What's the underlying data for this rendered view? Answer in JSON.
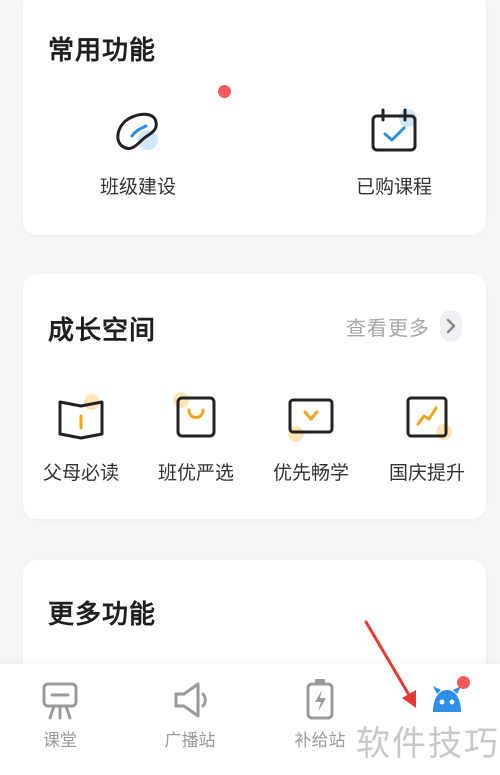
{
  "common": {
    "title": "常用功能",
    "items": [
      {
        "label": "班级建设",
        "icon": "bean-icon"
      },
      {
        "label": "已购课程",
        "icon": "calendar-check-icon"
      }
    ]
  },
  "growth": {
    "title": "成长空间",
    "more_label": "查看更多",
    "items": [
      {
        "label": "父母必读",
        "icon": "open-book-icon"
      },
      {
        "label": "班优严选",
        "icon": "shopping-bag-icon"
      },
      {
        "label": "优先畅学",
        "icon": "video-play-icon"
      },
      {
        "label": "国庆提升",
        "icon": "trend-board-icon"
      }
    ]
  },
  "more_features": {
    "title": "更多功能"
  },
  "tabbar": {
    "tabs": [
      {
        "label": "课堂",
        "icon": "classroom-screen-icon"
      },
      {
        "label": "广播站",
        "icon": "speaker-icon"
      },
      {
        "label": "补给站",
        "icon": "battery-charge-icon"
      },
      {
        "label": "",
        "icon": "mascot-icon"
      }
    ]
  },
  "watermark": "软件技巧",
  "colors": {
    "accent_blue": "#2f8fe8",
    "accent_orange": "#f2a41f",
    "badge_red": "#f25b5b",
    "background": "#f5f6f8",
    "arrow_red": "#e53935"
  }
}
